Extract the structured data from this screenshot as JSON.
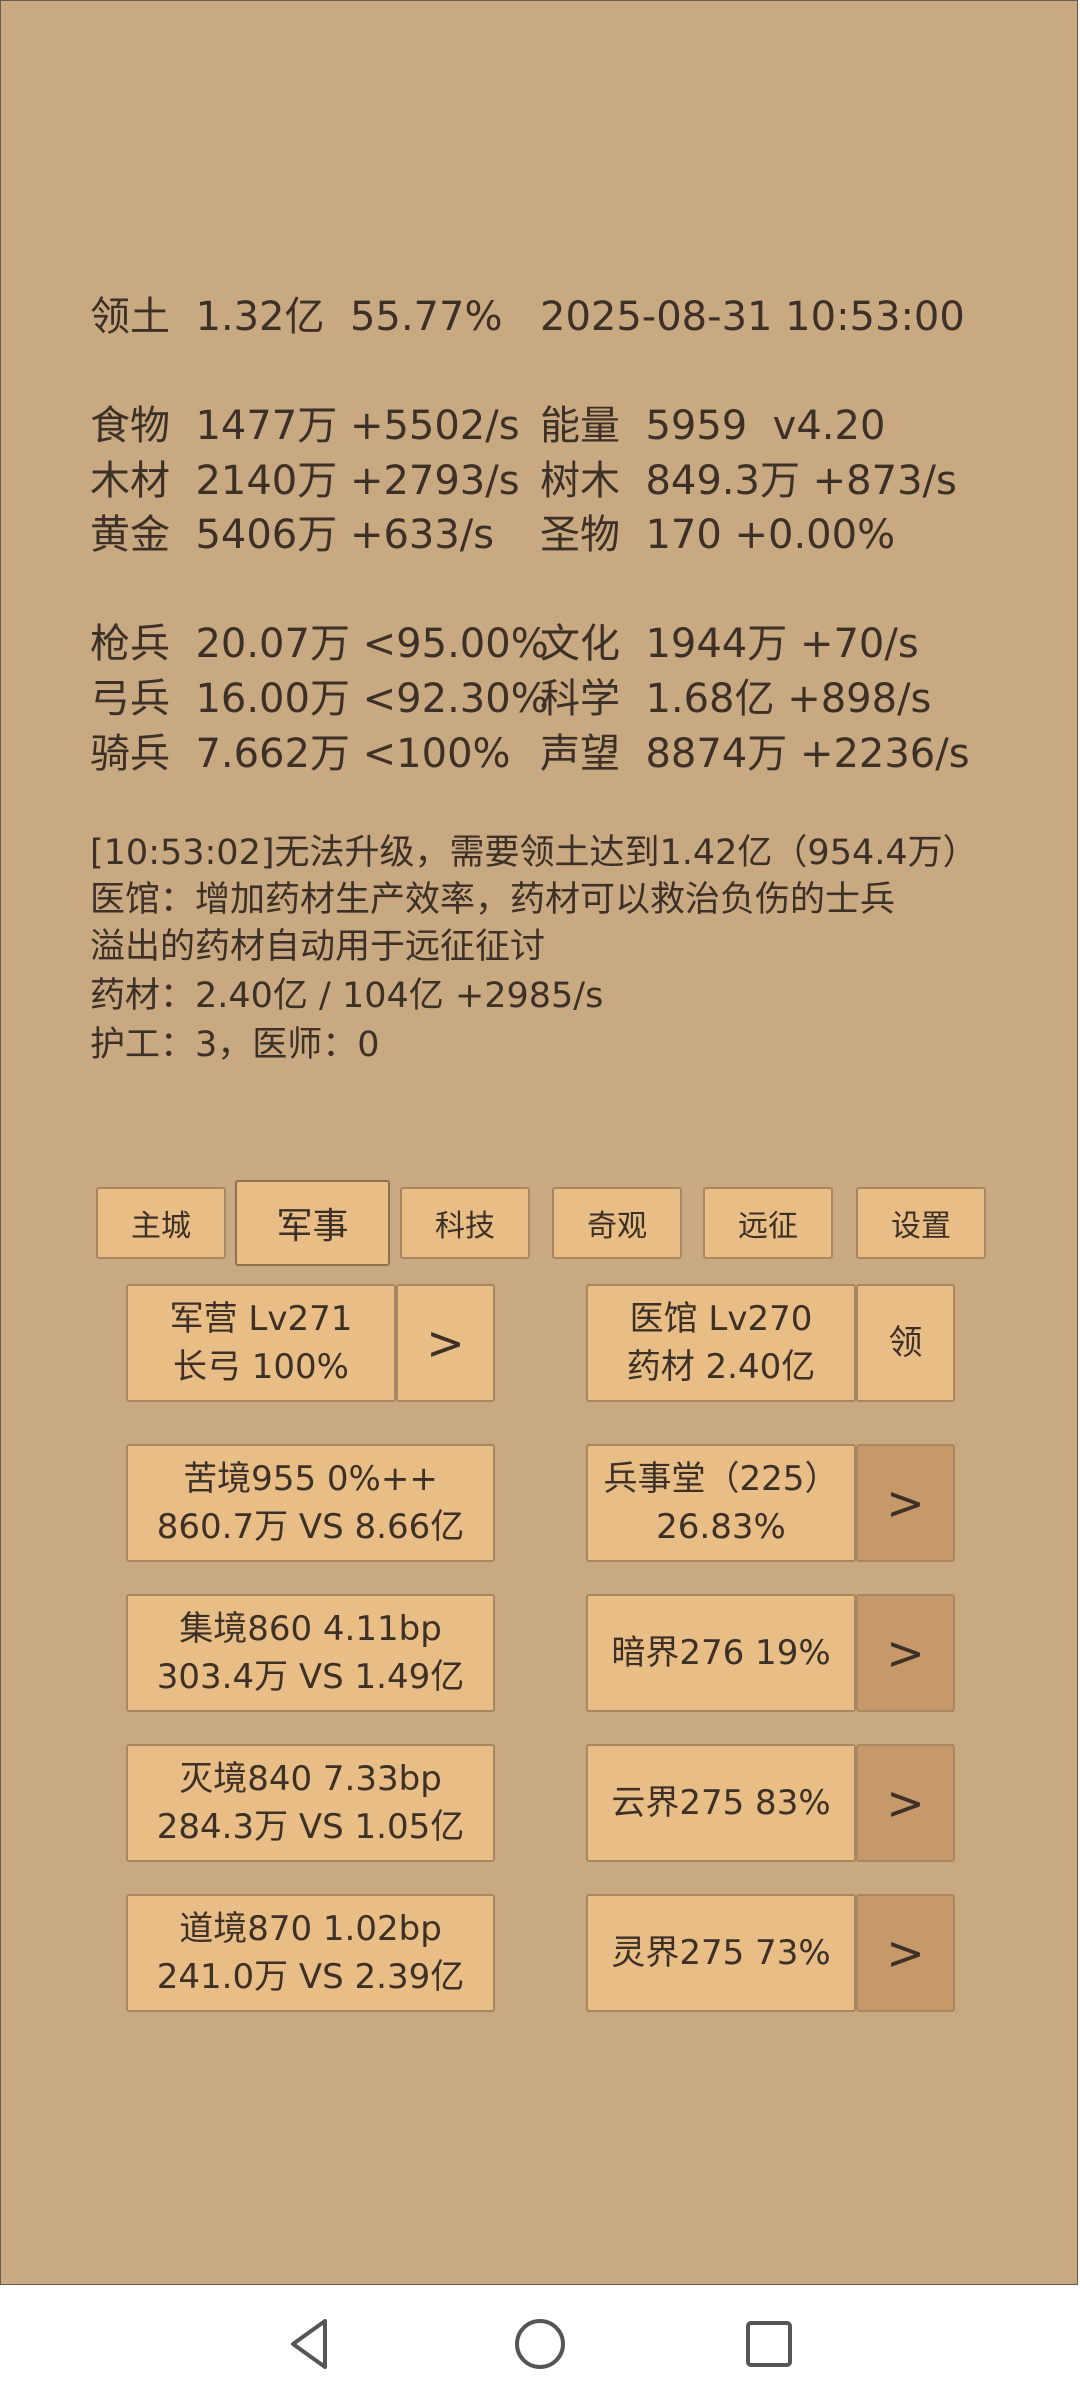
{
  "header": {
    "territory_label": "领土",
    "territory_value": "1.32亿",
    "territory_percent": "55.77%",
    "datetime": "2025-08-31 10:53:00"
  },
  "resources": [
    {
      "label": "食物",
      "value": "1477万 +5502/s"
    },
    {
      "label": "能量",
      "value": "5959  v4.20"
    },
    {
      "label": "木材",
      "value": "2140万 +2793/s"
    },
    {
      "label": "树木",
      "value": "849.3万 +873/s"
    },
    {
      "label": "黄金",
      "value": "5406万 +633/s"
    },
    {
      "label": "圣物",
      "value": "170 +0.00%"
    }
  ],
  "stats": [
    {
      "label": "枪兵",
      "value": "20.07万 <95.00%"
    },
    {
      "label": "文化",
      "value": "1944万 +70/s"
    },
    {
      "label": "弓兵",
      "value": "16.00万 <92.30%"
    },
    {
      "label": "科学",
      "value": "1.68亿 +898/s"
    },
    {
      "label": "骑兵",
      "value": "7.662万 <100%"
    },
    {
      "label": "声望",
      "value": "8874万 +2236/s"
    }
  ],
  "messages": [
    "[10:53:02]无法升级，需要领土达到1.42亿（954.4万）",
    "医馆：增加药材生产效率，药材可以救治负伤的士兵",
    "溢出的药材自动用于远征征讨",
    "药材：2.40亿 / 104亿 +2985/s",
    "护工：3，医师：0"
  ],
  "tabs": [
    "主城",
    "军事",
    "科技",
    "奇观",
    "远征",
    "设置"
  ],
  "active_tab": "军事",
  "barracks": {
    "line1": "军营 Lv271",
    "line2": "长弓 100%",
    "button": ">"
  },
  "hospital": {
    "line1": "医馆 Lv270",
    "line2": "药材 2.40亿",
    "button": "领"
  },
  "realms": [
    {
      "line1": "苦境955  0%++",
      "line2": "860.7万 VS 8.66亿"
    },
    {
      "line1": "集境860  4.11bp",
      "line2": "303.4万 VS 1.49亿"
    },
    {
      "line1": "灭境840  7.33bp",
      "line2": "284.3万 VS 1.05亿"
    },
    {
      "line1": "道境870  1.02bp",
      "line2": "241.0万 VS 2.39亿"
    }
  ],
  "halls": [
    {
      "line1": "兵事堂（225）",
      "line2": "26.83%",
      "button": ">"
    },
    {
      "line1": "暗界276  19%",
      "button": ">"
    },
    {
      "line1": "云界275  83%",
      "button": ">"
    },
    {
      "line1": "灵界275  73%",
      "button": ">"
    }
  ],
  "colors": {
    "background": "#c9a982",
    "button": "#e8bd86",
    "button_dark": "#c7986a",
    "text": "#3d3026"
  },
  "navbar_icons": [
    "back-icon",
    "home-icon",
    "recents-icon"
  ]
}
